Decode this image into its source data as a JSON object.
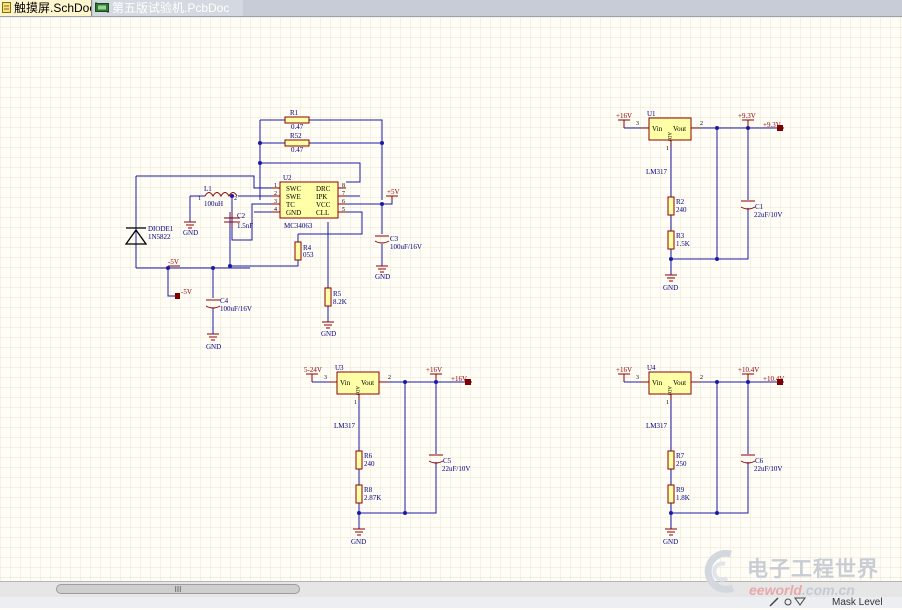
{
  "tabs": [
    {
      "label": "触摸屏.SchDoc",
      "active": true
    },
    {
      "label": "第五版试验机.PcbDoc",
      "active": false
    }
  ],
  "schematic": {
    "regulator_tl": {
      "chip_ref": "U2",
      "chip_part": "MC34063",
      "pins_left": [
        "SWC",
        "SWE",
        "TC",
        "GND"
      ],
      "pins_right": [
        "DRC",
        "IPK",
        "VCC",
        "CLL"
      ],
      "pin_nums_left": [
        "1",
        "2",
        "3",
        "4"
      ],
      "pin_nums_right": [
        "8",
        "7",
        "6",
        "5"
      ],
      "r1_ref": "R1",
      "r1_val": "0.47",
      "r52_ref": "R52",
      "r52_val": "0.47",
      "l1_ref": "L1",
      "l1_val": "100uH",
      "l1_pin1": "1",
      "l1_pin2": "2",
      "c2_ref": "C2",
      "c2_val": "1.5nF",
      "r4_ref": "R4",
      "r4_val": "053",
      "r5_ref": "R5",
      "r5_val": "8.2K",
      "c3_ref": "C3",
      "c3_val": "100uF/16V",
      "c4_ref": "C4",
      "c4_val": "100uF/16V",
      "d_ref": "DIODE1",
      "d_val": "1N5822",
      "net_p5v": "+5V",
      "net_m5v": "-5V",
      "net_m5v_port": "-5V",
      "gnd_labels": [
        "GND",
        "GND",
        "GND",
        "GND"
      ]
    },
    "regulators_317": [
      {
        "ref": "U1",
        "vin_net": "+16V",
        "vin_pin": "3",
        "vout_pin": "2",
        "adj_pin": "1",
        "out_net": "+9.3V",
        "port": "+9.3V",
        "vin_label": "Vin",
        "vout_label": "Vout",
        "adj_label": "ADJ",
        "part": "LM317",
        "c_ref": "C1",
        "c_val": "22uF/10V",
        "ra_ref": "R2",
        "ra_val": "240",
        "rb_ref": "R3",
        "rb_val": "1.5K",
        "gnd": "GND"
      },
      {
        "ref": "U3",
        "vin_net": "5-24V",
        "vin_pin": "3",
        "vout_pin": "2",
        "adj_pin": "1",
        "out_net": "+16V",
        "port": "+16V",
        "vin_label": "Vin",
        "vout_label": "Vout",
        "adj_label": "ADJ",
        "part": "LM317",
        "c_ref": "C5",
        "c_val": "22uF/10V",
        "ra_ref": "R6",
        "ra_val": "240",
        "rb_ref": "R8",
        "rb_val": "2.87K",
        "gnd": "GND"
      },
      {
        "ref": "U4",
        "vin_net": "+16V",
        "vin_pin": "3",
        "vout_pin": "2",
        "adj_pin": "1",
        "out_net": "+10.4V",
        "port": "+10.4V",
        "vin_label": "Vin",
        "vout_label": "Vout",
        "adj_label": "ADJ",
        "part": "LM317",
        "c_ref": "C6",
        "c_val": "22uF/10V",
        "ra_ref": "R7",
        "ra_val": "250",
        "rb_ref": "R9",
        "rb_val": "1.8K",
        "gnd": "GND"
      }
    ],
    "colors": {
      "wire": "#1a1aa8",
      "part": "#8b0000",
      "label": "#000080",
      "body": "#ffffa8",
      "grid": "#e7e2d2"
    }
  },
  "scrollbar": {
    "thumb_grip": "III"
  },
  "status": {
    "mask_level": "Mask Level"
  },
  "watermark": {
    "title": "电子工程世界",
    "url_main": "eeworld",
    "url_tail": ".com.cn"
  }
}
